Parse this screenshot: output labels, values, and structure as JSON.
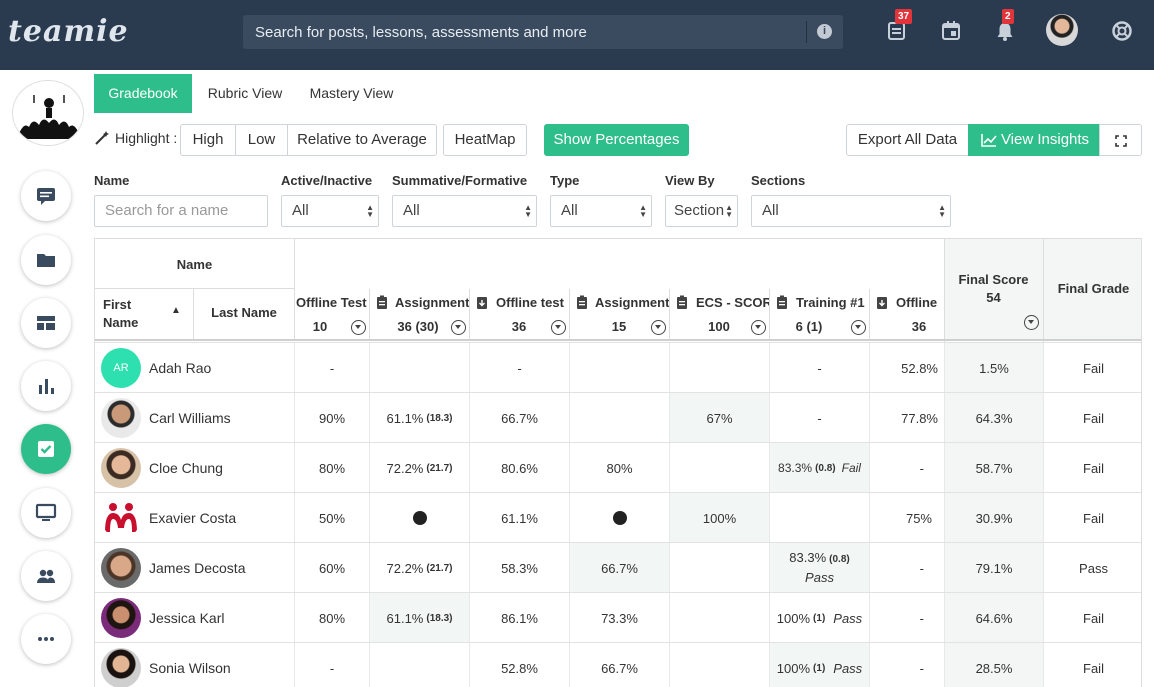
{
  "header": {
    "logo": "teamie",
    "search_placeholder": "Search for posts, lessons, assessments and more",
    "info_icon": "i",
    "badges": {
      "posts": "37",
      "notifications": "2"
    }
  },
  "tabs": [
    {
      "label": "Gradebook",
      "active": true
    },
    {
      "label": "Rubric View",
      "active": false
    },
    {
      "label": "Mastery View",
      "active": false
    }
  ],
  "toolbar": {
    "highlight_label": "Highlight :",
    "high": "High",
    "low": "Low",
    "relative": "Relative to Average",
    "heatmap": "HeatMap",
    "show_percentages": "Show Percentages",
    "export": "Export All Data",
    "view_insights": "View Insights"
  },
  "filters": {
    "name_label": "Name",
    "name_placeholder": "Search for a name",
    "active_label": "Active/Inactive",
    "active_value": "All",
    "summative_label": "Summative/Formative",
    "summative_value": "All",
    "type_label": "Type",
    "type_value": "All",
    "viewby_label": "View By",
    "viewby_value": "Section",
    "sections_label": "Sections",
    "sections_value": "All"
  },
  "grid": {
    "name_header": "Name",
    "first_name": "First Name",
    "last_name": "Last Name",
    "final_score_label": "Final Score",
    "final_score_value": "54",
    "final_grade_label": "Final Grade",
    "columns": [
      {
        "title": "Offline Test",
        "sub": "10",
        "icon": "none"
      },
      {
        "title": "Assignment",
        "sub": "36 (30)",
        "icon": "clipboard"
      },
      {
        "title": "Offline test",
        "sub": "36",
        "icon": "download"
      },
      {
        "title": "Assignment",
        "sub": "15",
        "icon": "clipboard"
      },
      {
        "title": "ECS - SCORM",
        "sub": "100",
        "icon": "clipboard"
      },
      {
        "title": "Training #1",
        "sub": "6 (1)",
        "icon": "clipboard"
      },
      {
        "title": "Offline",
        "sub": "36",
        "icon": "download"
      }
    ],
    "rows": [
      {
        "name": "Adah Rao",
        "initials": "AR",
        "cells": [
          "-",
          "",
          "-",
          "",
          "",
          "-",
          "52.8%"
        ],
        "score": "1.5%",
        "grade": "Fail"
      },
      {
        "name": "Carl Williams",
        "cells": [
          "90%",
          "61.1%|(18.3)",
          "66.7%",
          "",
          "67%",
          "-",
          "77.8%"
        ],
        "score": "64.3%",
        "grade": "Fail"
      },
      {
        "name": "Cloe Chung",
        "cells": [
          "80%",
          "72.2%|(21.7)",
          "80.6%",
          "80%",
          "",
          "83.3%|(0.8)|Fail",
          "-"
        ],
        "score": "58.7%",
        "grade": "Fail"
      },
      {
        "name": "Exavier Costa",
        "cells": [
          "50%",
          "•",
          "61.1%",
          "•",
          "100%",
          "",
          "75%"
        ],
        "score": "30.9%",
        "grade": "Fail"
      },
      {
        "name": "James Decosta",
        "cells": [
          "60%",
          "72.2%|(21.7)",
          "58.3%",
          "66.7%",
          "",
          "83.3%|(0.8)|Pass",
          "-"
        ],
        "score": "79.1%",
        "grade": "Pass"
      },
      {
        "name": "Jessica Karl",
        "cells": [
          "80%",
          "61.1%|(18.3)",
          "86.1%",
          "73.3%",
          "",
          "100%|(1)|Pass",
          "-"
        ],
        "score": "64.6%",
        "grade": "Fail"
      },
      {
        "name": "Sonia Wilson",
        "cells": [
          "-",
          "",
          "52.8%",
          "66.7%",
          "",
          "100%|(1)|Pass",
          "-"
        ],
        "score": "28.5%",
        "grade": "Fail"
      }
    ]
  }
}
